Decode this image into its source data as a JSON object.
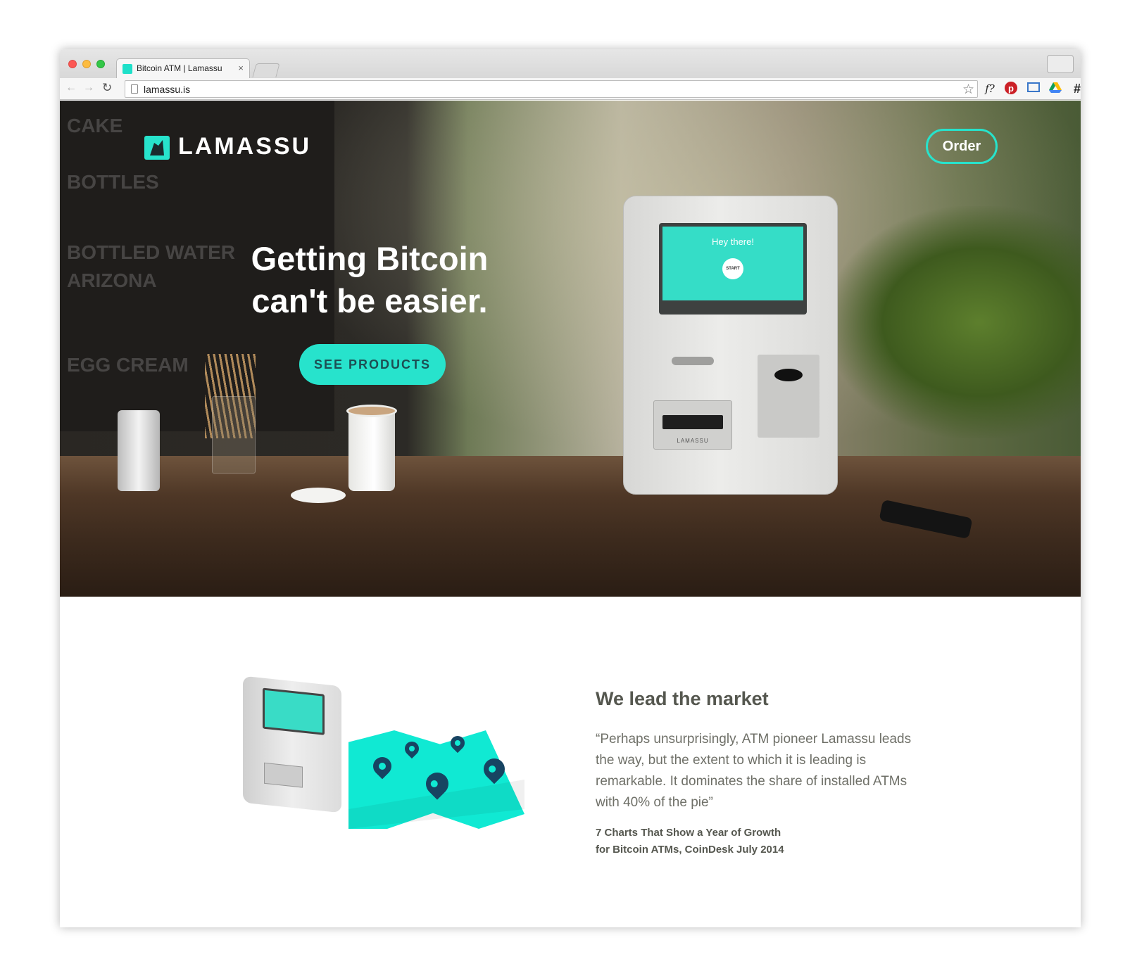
{
  "browser": {
    "tab_title": "Bitcoin ATM | Lamassu",
    "tab_close": "×",
    "url": "lamassu.is",
    "icons": {
      "back": "back-arrow-icon",
      "forward": "forward-arrow-icon",
      "reload": "reload-icon",
      "star": "bookmark-star-icon",
      "ext_font": "f?",
      "ext_pinterest": "pinterest-icon",
      "ext_cast": "cast-icon",
      "ext_drive": "drive-icon",
      "ext_hash": "#",
      "ext_camera": "camera-icon",
      "menu": "≡"
    }
  },
  "hero": {
    "logo_text": "LAMASSU",
    "order_label": "Order",
    "headline_line1": "Getting Bitcoin",
    "headline_line2": "can't be easier.",
    "cta_label": "SEE PRODUCTS",
    "atm_greeting": "Hey there!",
    "atm_start": "START",
    "atm_brand": "LAMASSU"
  },
  "market": {
    "heading": "We lead the market",
    "quote": "“Perhaps unsurprisingly, ATM pioneer Lamassu leads the way, but the extent to which it is leading is remarkable. It dominates the share of installed ATMs with 40% of the pie”",
    "source_line1": "7 Charts That Show a Year of Growth",
    "source_line2": "for Bitcoin ATMs, CoinDesk July 2014"
  },
  "colors": {
    "accent": "#27e3cc",
    "map": "#10e9d3",
    "pin": "#174462",
    "text_dark": "#55574f",
    "text_body": "#6f7068"
  }
}
